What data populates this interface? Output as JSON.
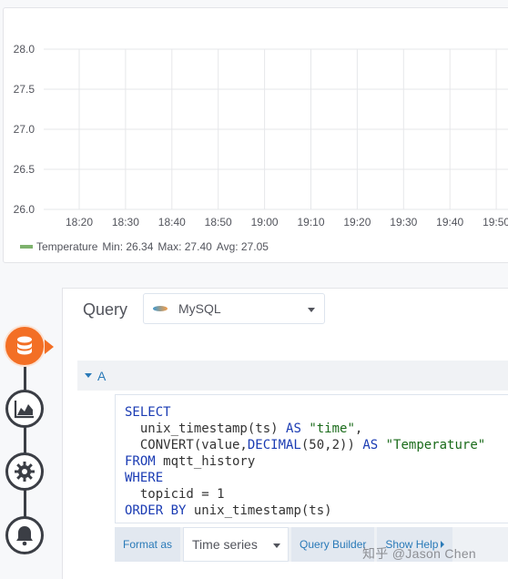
{
  "chart_data": {
    "type": "line",
    "title": "",
    "xlabel": "",
    "ylabel": "",
    "y_ticks": [
      "28.0",
      "27.5",
      "27.0",
      "26.5",
      "26.0"
    ],
    "x_ticks": [
      "18:20",
      "18:30",
      "18:40",
      "18:50",
      "19:00",
      "19:10",
      "19:20",
      "19:30",
      "19:40",
      "19:50"
    ],
    "ylim": [
      26.0,
      28.0
    ],
    "grid": true,
    "series": [
      {
        "name": "Temperature",
        "color": "#7eb26d",
        "values": []
      }
    ],
    "legend_position": "bottom-left"
  },
  "legend": {
    "series_name": "Temperature",
    "min_text": "Min: 26.34",
    "max_text": "Max: 27.40",
    "avg_text": "Avg: 27.05"
  },
  "query": {
    "title": "Query",
    "datasource": "MySQL",
    "row_label": "A",
    "sql_lines": [
      [
        {
          "t": "SELECT",
          "c": "kw"
        }
      ],
      [
        {
          "t": "  unix_timestamp(ts) ",
          "c": ""
        },
        {
          "t": "AS",
          "c": "kw"
        },
        {
          "t": " ",
          "c": ""
        },
        {
          "t": "\"time\"",
          "c": "str"
        },
        {
          "t": ",",
          "c": ""
        }
      ],
      [
        {
          "t": "  CONVERT(value,",
          "c": ""
        },
        {
          "t": "DECIMAL",
          "c": "kw"
        },
        {
          "t": "(50,2)) ",
          "c": ""
        },
        {
          "t": "AS",
          "c": "kw"
        },
        {
          "t": " ",
          "c": ""
        },
        {
          "t": "\"Temperature\"",
          "c": "str"
        }
      ],
      [
        {
          "t": "FROM",
          "c": "kw"
        },
        {
          "t": " mqtt_history",
          "c": ""
        }
      ],
      [
        {
          "t": "WHERE",
          "c": "kw"
        }
      ],
      [
        {
          "t": "  topicid = 1",
          "c": ""
        }
      ],
      [
        {
          "t": "ORDER BY",
          "c": "kw"
        },
        {
          "t": " unix_timestamp(ts)",
          "c": ""
        }
      ]
    ],
    "format_as_label": "Format as",
    "format_value": "Time series",
    "query_builder_label": "Query Builder",
    "show_help_label": "Show Help"
  },
  "nav": {
    "items": [
      {
        "name": "nav-queries-icon",
        "icon": "database-icon",
        "active": true
      },
      {
        "name": "nav-visualization-icon",
        "icon": "area-chart-icon",
        "active": false
      },
      {
        "name": "nav-general-icon",
        "icon": "gear-icon",
        "active": false
      },
      {
        "name": "nav-alert-icon",
        "icon": "bell-icon",
        "active": false
      }
    ],
    "accent_color": "#f36f25"
  },
  "watermark": "知乎 @Jason Chen"
}
